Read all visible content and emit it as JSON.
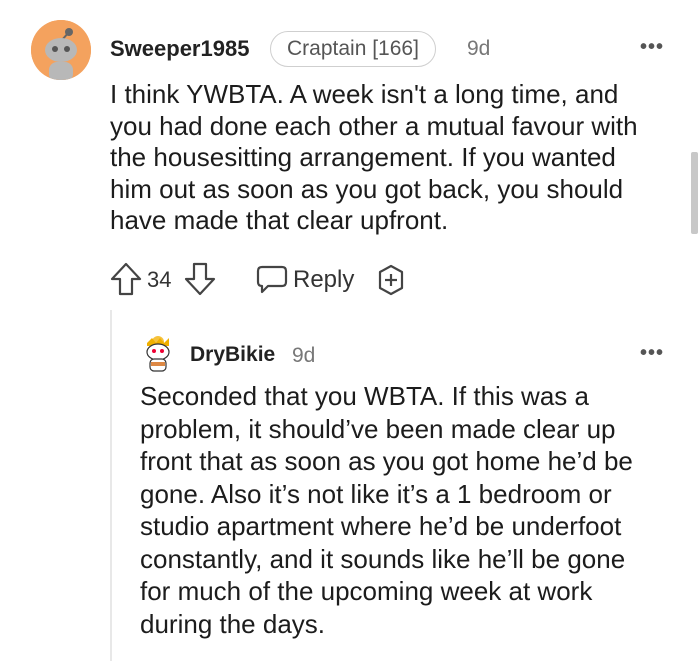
{
  "comment": {
    "username": "Sweeper1985",
    "flair": "Craptain [166]",
    "time": "9d",
    "more": "•••",
    "body_lines": [
      "I think YWBTA. A week isn't a long time, and",
      "you had done each other a mutual favour with",
      "the housesitting arrangement. If you wanted",
      "him out as soon as you got back, you should",
      "have made that clear upfront."
    ],
    "score": "34",
    "reply_label": "Reply"
  },
  "reply": {
    "username": "DryBikie",
    "time": "9d",
    "more": "•••",
    "body_lines": [
      "Seconded that you WBTA. If this was a",
      "problem, it should’ve been made clear up",
      "front that as soon as you got home he’d be",
      "gone. Also it’s not like it’s a 1 bedroom or",
      "studio apartment where he’d be underfoot",
      "constantly, and it sounds like he’ll be gone",
      "for much of the upcoming week at work",
      "during the days."
    ]
  },
  "colors": {
    "avatar_bg": "#f4a25e",
    "text": "#1c1c1c",
    "muted": "#777777",
    "icon": "#555555"
  },
  "icons": [
    "upvote-icon",
    "downvote-icon",
    "comment-bubble-icon",
    "award-plus-icon",
    "more-options-icon"
  ]
}
